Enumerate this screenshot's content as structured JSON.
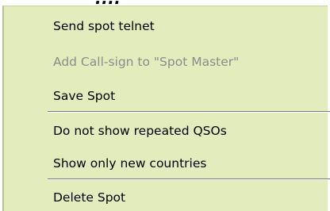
{
  "header": {
    "fragment_text": "...."
  },
  "context_menu": {
    "items": [
      {
        "label": "Send spot telnet",
        "enabled": true
      },
      {
        "label": "Add Call-sign to \"Spot Master\"",
        "enabled": false
      },
      {
        "label": "Save Spot",
        "enabled": true
      },
      {
        "label": "Do not show repeated QSOs",
        "enabled": true
      },
      {
        "label": "Show only new countries",
        "enabled": true
      },
      {
        "label": "Delete Spot",
        "enabled": true
      }
    ]
  },
  "colors": {
    "menu_background": "#e2ecbd",
    "disabled_text": "#8c8c8c",
    "separator": "#7a7a7a"
  }
}
